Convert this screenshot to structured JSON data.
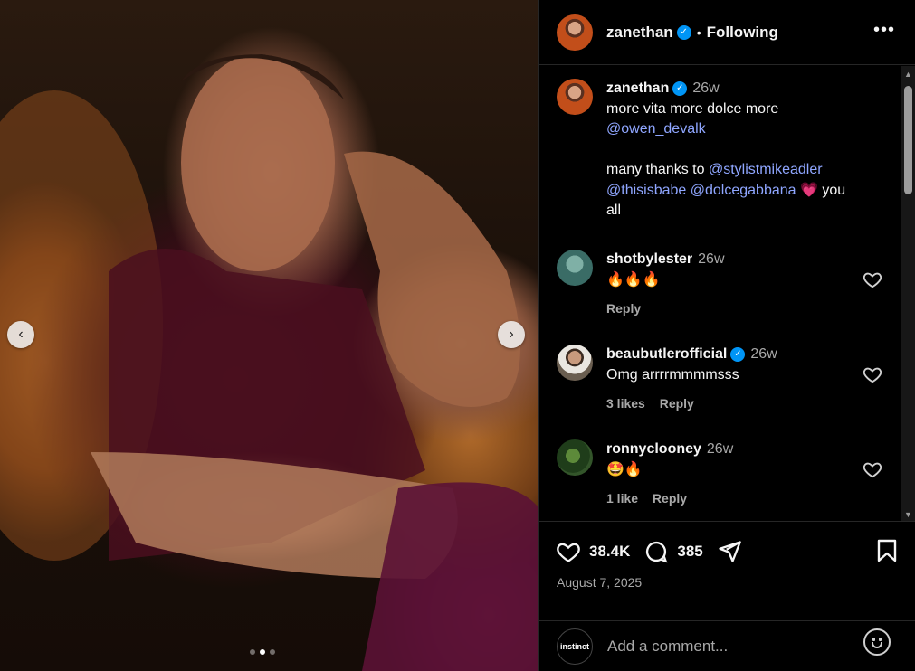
{
  "media": {
    "prev_icon": "‹",
    "next_icon": "›",
    "slides": [
      1,
      2,
      3
    ],
    "active_slide": 2
  },
  "header": {
    "username": "zanethan",
    "separator": "•",
    "follow_status": "Following",
    "more_icon": "•••"
  },
  "caption": {
    "username": "zanethan",
    "time": "26w",
    "line1": "more vita more dolce more",
    "mention1": "@owen_devalk",
    "line2": "many thanks to",
    "mention2": "@stylistmikeadler",
    "mention3": "@thisisbabe",
    "mention4": "@dolcegabbana",
    "emoji": "💗",
    "tail1": "you",
    "tail2": "all"
  },
  "comments": [
    {
      "username": "shotbylester",
      "time": "26w",
      "text": "🔥🔥🔥",
      "likes": "",
      "reply": "Reply",
      "verified": false
    },
    {
      "username": "beaubutlerofficial",
      "time": "26w",
      "text": "Omg arrrrmmmmsss",
      "likes": "3 likes",
      "reply": "Reply",
      "verified": true
    },
    {
      "username": "ronnyclooney",
      "time": "26w",
      "text": "🤩🔥",
      "likes": "1 like",
      "reply": "Reply",
      "verified": false
    }
  ],
  "actions": {
    "likes": "38.4K",
    "comments": "385",
    "date": "August 7, 2025"
  },
  "add_comment": {
    "placeholder": "Add a comment...",
    "avatar_text": "instinct"
  },
  "colors": {
    "accent": "#0095f6",
    "link": "#8fa6ff",
    "background": "#000000"
  }
}
